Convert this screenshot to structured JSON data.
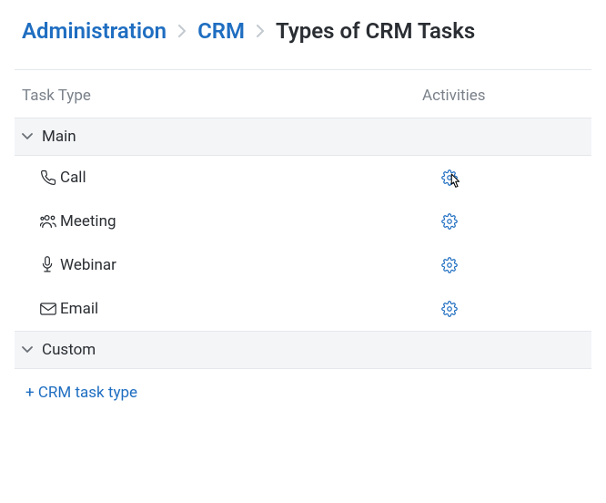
{
  "breadcrumb": {
    "administration": "Administration",
    "crm": "CRM",
    "current": "Types of CRM Tasks"
  },
  "headers": {
    "task_type": "Task Type",
    "activities": "Activities"
  },
  "sections": {
    "main": {
      "label": "Main"
    },
    "custom": {
      "label": "Custom"
    }
  },
  "tasks": {
    "main": [
      {
        "name": "Call",
        "icon": "phone"
      },
      {
        "name": "Meeting",
        "icon": "people"
      },
      {
        "name": "Webinar",
        "icon": "microphone"
      },
      {
        "name": "Email",
        "icon": "envelope"
      }
    ]
  },
  "add_link": "+ CRM task type"
}
